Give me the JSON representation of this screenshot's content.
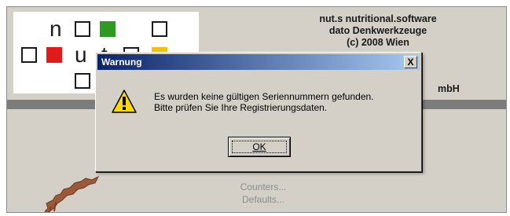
{
  "app": {
    "logo": {
      "letters": [
        "n",
        "u",
        "t"
      ]
    },
    "vendor": {
      "line1": "nut.s nutritional.software",
      "line2": "dato Denkwerkzeuge",
      "line3": "(c) 2008 Wien",
      "line4_partial": "mbH"
    },
    "links": {
      "counters": "Counters...",
      "defaults": "Defaults..."
    }
  },
  "dialog": {
    "title": "Warnung",
    "close_label": "X",
    "message_line1": "Es wurden keine gültigen Seriennummern gefunden.",
    "message_line2": "Bitte prüfen Sie Ihre Registrierungsdaten.",
    "ok_label": "OK"
  },
  "colors": {
    "logo_green": "#2e9a22",
    "logo_red": "#e01b1b",
    "logo_yellow": "#f2c200",
    "title_bar_start": "#0a246a",
    "title_bar_end": "#a6caf0",
    "warning_yellow": "#ffd800"
  },
  "icons": {
    "dialog_icon": "warning-icon",
    "close_icon": "close-icon"
  }
}
